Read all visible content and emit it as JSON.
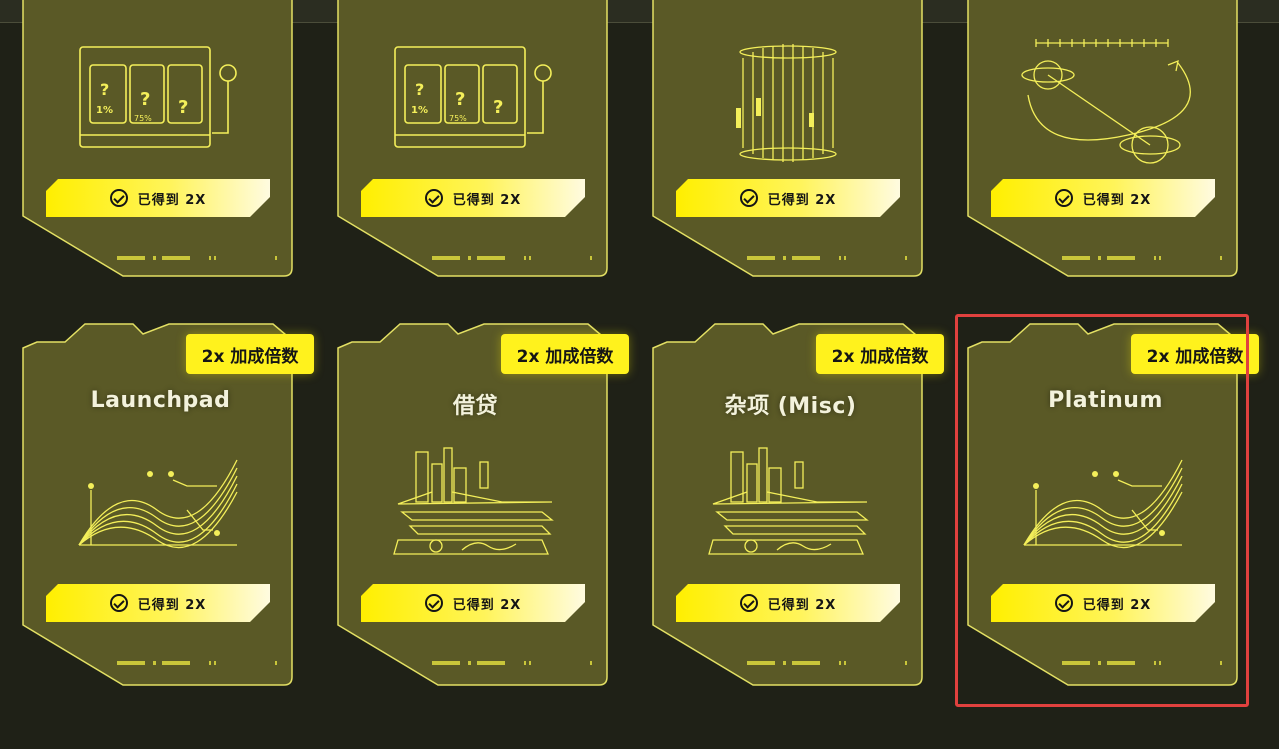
{
  "colors": {
    "background": "#1f2117",
    "card_fill": "#5a5926",
    "card_stroke": "#e3e064",
    "accent_yellow": "#fff21d",
    "highlight_red": "#e0413e"
  },
  "top_cards": [
    {
      "illustration": "slot-machine-icon",
      "status_label": "已得到 2X"
    },
    {
      "illustration": "slot-machine-icon",
      "status_label": "已得到 2X"
    },
    {
      "illustration": "candlestick-cylinder-icon",
      "status_label": "已得到 2X"
    },
    {
      "illustration": "orbit-trajectory-icon",
      "status_label": "已得到 2X"
    }
  ],
  "bottom_cards": [
    {
      "title": "Launchpad",
      "badge": "2x 加成倍数",
      "illustration": "wave-lines-chart-icon",
      "status_label": "已得到 2X"
    },
    {
      "title": "借贷",
      "badge": "2x 加成倍数",
      "illustration": "city-dashboard-icon",
      "status_label": "已得到 2X"
    },
    {
      "title": "杂项 (Misc)",
      "badge": "2x 加成倍数",
      "illustration": "city-dashboard-icon",
      "status_label": "已得到 2X"
    },
    {
      "title": "Platinum",
      "badge": "2x 加成倍数",
      "illustration": "wave-lines-chart-icon",
      "status_label": "已得到 2X"
    }
  ]
}
